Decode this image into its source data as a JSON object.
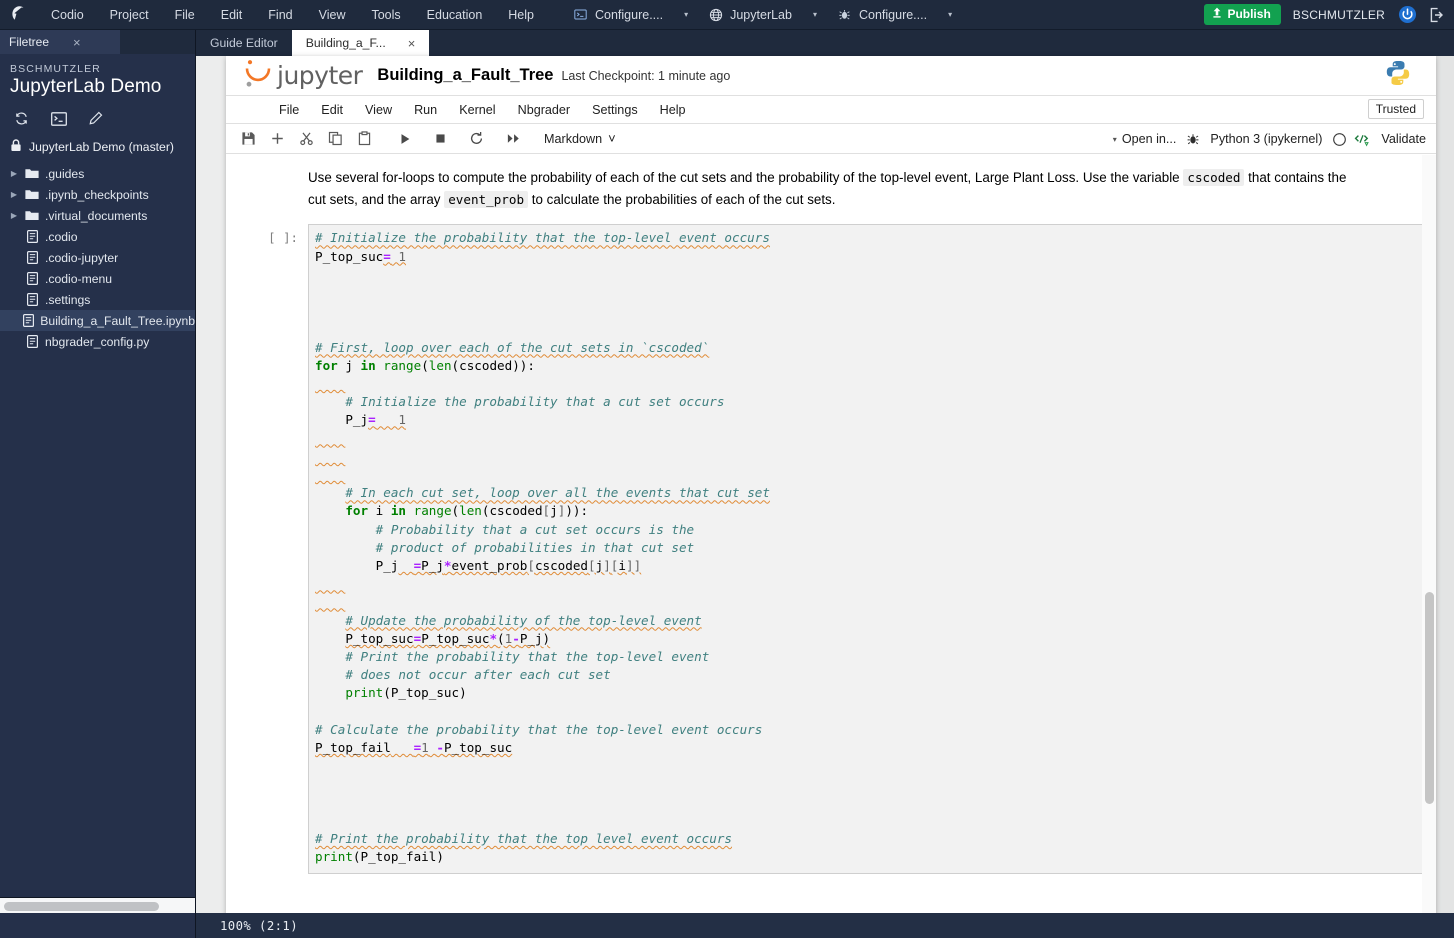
{
  "topbar": {
    "logo": "codio-logo",
    "menu": [
      "Codio",
      "Project",
      "File",
      "Edit",
      "Find",
      "View",
      "Tools",
      "Education",
      "Help"
    ],
    "tool_items": [
      {
        "icon": "terminal-icon",
        "label": "Configure....",
        "caret": "▾"
      },
      {
        "icon": "globe-icon",
        "label": "JupyterLab",
        "caret": "▾"
      },
      {
        "icon": "bug-icon",
        "label": "Configure....",
        "caret": "▾"
      }
    ],
    "publish_label": "Publish",
    "publish_color": "#12a150",
    "username": "BSCHMUTZLER",
    "power_icon": "power-icon",
    "logout_icon": "logout-icon"
  },
  "sidebar": {
    "tab_label": "Filetree",
    "tab_close": "×",
    "user": "BSCHMUTZLER",
    "project_title": "JupyterLab Demo",
    "tools": [
      "refresh-icon",
      "terminal-icon",
      "edit-icon"
    ],
    "repo_label": "JupyterLab Demo (master)",
    "tree": [
      {
        "name": ".guides",
        "type": "folder",
        "expandable": true,
        "selected": false
      },
      {
        "name": ".ipynb_checkpoints",
        "type": "folder",
        "expandable": true,
        "selected": false
      },
      {
        "name": ".virtual_documents",
        "type": "folder",
        "expandable": true,
        "selected": false
      },
      {
        "name": ".codio",
        "type": "file",
        "expandable": false,
        "selected": false
      },
      {
        "name": ".codio-jupyter",
        "type": "file",
        "expandable": false,
        "selected": false
      },
      {
        "name": ".codio-menu",
        "type": "file",
        "expandable": false,
        "selected": false
      },
      {
        "name": ".settings",
        "type": "file",
        "expandable": false,
        "selected": false
      },
      {
        "name": "Building_a_Fault_Tree.ipynb",
        "type": "file",
        "expandable": false,
        "selected": true
      },
      {
        "name": "nbgrader_config.py",
        "type": "file",
        "expandable": false,
        "selected": false
      }
    ]
  },
  "tabs": [
    {
      "label": "Guide Editor",
      "active": false,
      "closable": false
    },
    {
      "label": "Building_a_F...",
      "active": true,
      "closable": true,
      "close": "×"
    }
  ],
  "notebook": {
    "brand": "jupyter",
    "name": "Building_a_Fault_Tree",
    "checkpoint": "Last Checkpoint: 1 minute ago",
    "kernel_logo": "python-logo",
    "menu": [
      "File",
      "Edit",
      "View",
      "Run",
      "Kernel",
      "Nbgrader",
      "Settings",
      "Help"
    ],
    "trusted_label": "Trusted",
    "toolbar_icons": [
      "save-icon",
      "add-cell-icon",
      "cut-icon",
      "copy-icon",
      "paste-icon",
      "run-icon",
      "stop-icon",
      "restart-icon",
      "restart-run-all-icon"
    ],
    "cell_type": "Markdown",
    "cell_type_caret": "⌄",
    "open_in_label": "Open in...",
    "open_in_caret": "▾",
    "debug_icon": "bug-icon",
    "kernel_name": "Python 3 (ipykernel)",
    "kernel_status_icon": "kernel-idle-circle-icon",
    "lsp_icon": "code-brackets-icon",
    "validate_label": "Validate"
  },
  "markdown": {
    "p1_a": "Use several for-loops to compute the probability of each of the cut sets and the probability of the top-level event, Large Plant Loss. Use the variable ",
    "p1_code1": "cscoded",
    "p1_b": " that contains the cut sets, and the array ",
    "p1_code2": "event_prob",
    "p1_c": " to calculate the probabilities of each of the cut sets."
  },
  "cell": {
    "prompt": "[ ]:",
    "code_lines": [
      "# Initialize the probability that the top-level event occurs",
      "P_top_suc= 1",
      "",
      "",
      "",
      "",
      "# First, loop over each of the cut sets in `cscoded`",
      "for j in range(len(cscoded)):",
      "",
      "    # Initialize the probability that a cut set occurs",
      "    P_j=   1",
      "",
      "",
      "",
      "    # In each cut set, loop over all the events that cut set",
      "    for i in range(len(cscoded[j])):",
      "        # Probability that a cut set occurs is the",
      "        # product of probabilities in that cut set",
      "        P_j  =P_j*event_prob[cscoded[j][i]]",
      "",
      "",
      "    # Update the probability of the top-level event",
      "    P_top_suc=P_top_suc*(1-P_j)",
      "    # Print the probability that the top-level event",
      "    # does not occur after each cut set",
      "    print(P_top_suc)",
      "",
      "# Calculate the probability that the top-level event occurs",
      "P_top_fail   =1 -P_top_suc",
      "",
      "",
      "",
      "",
      "# Print the probability that the top level event occurs",
      "print(P_top_fail)"
    ]
  },
  "statusbar": {
    "text": "100%  (2:1)"
  }
}
